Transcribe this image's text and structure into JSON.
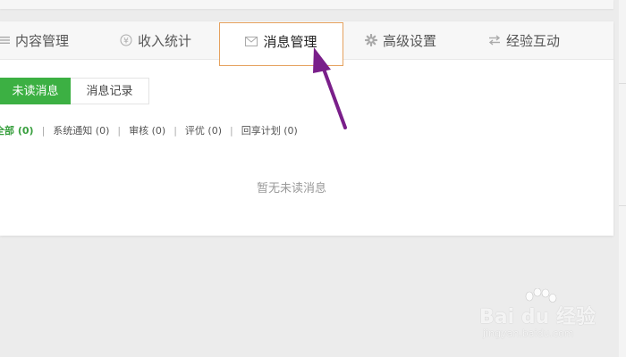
{
  "tabs": [
    {
      "icon": "list-icon",
      "label": "内容管理"
    },
    {
      "icon": "yen-icon",
      "label": "收入统计"
    },
    {
      "icon": "envelope-icon",
      "label": "消息管理",
      "active": true
    },
    {
      "icon": "gear-icon",
      "label": "高级设置"
    },
    {
      "icon": "swap-icon",
      "label": "经验互动"
    }
  ],
  "subtabs": {
    "unread": "未读消息",
    "history": "消息记录"
  },
  "filters": [
    {
      "label": "全部",
      "count": "(0)"
    },
    {
      "label": "系统通知",
      "count": "(0)"
    },
    {
      "label": "审核",
      "count": "(0)"
    },
    {
      "label": "评优",
      "count": "(0)"
    },
    {
      "label": "回享计划",
      "count": "(0)"
    }
  ],
  "empty_message": "暂无未读消息",
  "watermark": {
    "brand": "Bai du 经验",
    "url": "jingyan.baidu.com"
  },
  "colors": {
    "accent_green": "#3cb043",
    "active_tab_border": "#e5a15e",
    "arrow": "#7a1f8a"
  }
}
